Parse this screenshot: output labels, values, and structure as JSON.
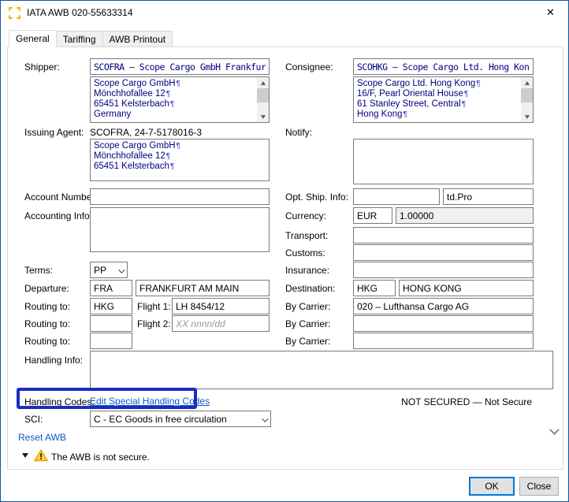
{
  "window": {
    "title": "IATA AWB 020-55633314"
  },
  "tabs": [
    {
      "label": "General",
      "active": true
    },
    {
      "label": "Tariffing",
      "active": false
    },
    {
      "label": "AWB Printout",
      "active": false
    }
  ],
  "form": {
    "shipper": {
      "label": "Shipper:",
      "code": "SCOFRA – Scope Cargo GmbH Frankfurt",
      "address": [
        {
          "text": "Scope Cargo GmbH",
          "mark": true
        },
        {
          "text": "Mönchhofallee 12",
          "mark": true
        },
        {
          "text": "65451 Kelsterbach",
          "mark": true
        },
        {
          "text": "Germany",
          "mark": false
        }
      ]
    },
    "consignee": {
      "label": "Consignee:",
      "code": "SCOHKG – Scope Cargo Ltd. Hong Kong",
      "address": [
        {
          "text": "Scope Cargo Ltd. Hong Kong",
          "mark": true
        },
        {
          "text": "16/F, Pearl Oriental House",
          "mark": true
        },
        {
          "text": "61 Stanley Street, Central",
          "mark": true
        },
        {
          "text": "Hong Kong",
          "mark": true
        }
      ]
    },
    "issuing_agent": {
      "label": "Issuing Agent:",
      "account": "SCOFRA, 24-7-5178016-3",
      "address": [
        {
          "text": "Scope Cargo GmbH",
          "mark": true
        },
        {
          "text": "Mönchhofallee 12",
          "mark": true
        },
        {
          "text": "65451 Kelsterbach",
          "mark": true
        }
      ]
    },
    "notify": {
      "label": "Notify:",
      "value": ""
    },
    "account_number": {
      "label": "Account Number:",
      "value": ""
    },
    "opt_ship_info": {
      "label": "Opt. Ship. Info:",
      "value": "",
      "pro": "td.Pro"
    },
    "accounting_info": {
      "label": "Accounting Info:",
      "value": ""
    },
    "currency": {
      "label": "Currency:",
      "code": "EUR",
      "rate": "1.00000"
    },
    "transport": {
      "label": "Transport:",
      "value": ""
    },
    "customs": {
      "label": "Customs:",
      "value": ""
    },
    "insurance": {
      "label": "Insurance:",
      "value": ""
    },
    "terms": {
      "label": "Terms:",
      "value": "PP"
    },
    "departure": {
      "label": "Departure:",
      "code": "FRA",
      "name": "FRANKFURT AM MAIN"
    },
    "destination": {
      "label": "Destination:",
      "code": "HKG",
      "name": "HONG KONG"
    },
    "routing": [
      {
        "label": "Routing to:",
        "code": "HKG",
        "flight_label": "Flight 1:",
        "flight": "LH 8454/12",
        "flight_placeholder": ""
      },
      {
        "label": "Routing to:",
        "code": "",
        "flight_label": "Flight 2:",
        "flight": "",
        "flight_placeholder": "XX nnnn/dd"
      },
      {
        "label": "Routing to:",
        "code": ""
      }
    ],
    "by_carrier": [
      {
        "label": "By Carrier:",
        "value": "020 – Lufthansa Cargo AG"
      },
      {
        "label": "By Carrier:",
        "value": ""
      },
      {
        "label": "By Carrier:",
        "value": ""
      }
    ],
    "handling_info": {
      "label": "Handling Info:",
      "value": ""
    },
    "handling_codes": {
      "label": "Handling Codes:",
      "link_label": "Edit Special Handling Codes"
    },
    "security_status": "NOT SECURED — Not Secure",
    "sci": {
      "label": "SCI:",
      "value": "C - EC Goods in free circulation"
    },
    "reset_link": "Reset AWB",
    "warning_message": "The AWB is not secure."
  },
  "buttons": {
    "ok": "OK",
    "close": "Close"
  },
  "colors": {
    "accent": "#0078d7",
    "annotation": "#1b2cc1",
    "link": "#0a5bc4",
    "mono_text": "#000080",
    "warning_fill": "#ffd042",
    "warning_stroke": "#e8a200"
  }
}
